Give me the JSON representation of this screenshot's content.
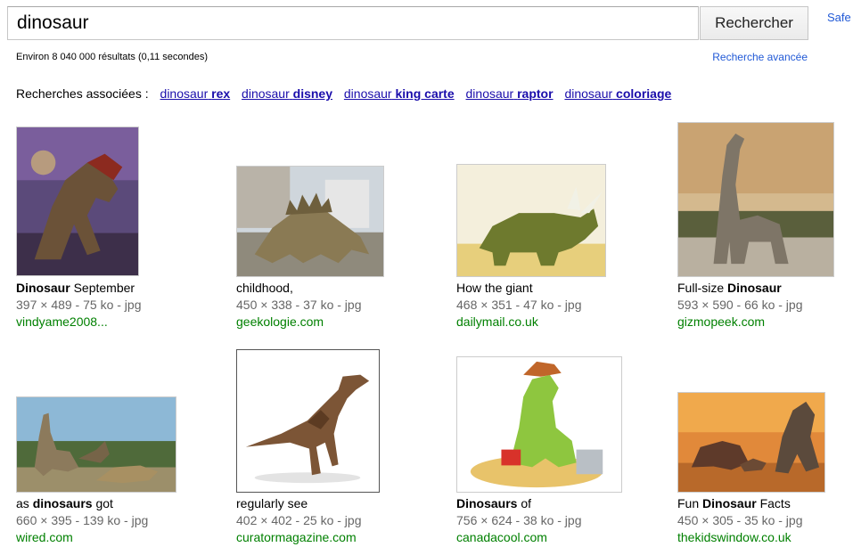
{
  "search": {
    "query": "dinosaur",
    "button_label": "Rechercher",
    "safe_label": "Safe"
  },
  "stats": {
    "text": "Environ 8 040 000 résultats (0,11 secondes)",
    "advanced_label": "Recherche avancée"
  },
  "related": {
    "label": "Recherches associées :",
    "items": [
      {
        "prefix": "dinosaur",
        "bold": "rex"
      },
      {
        "prefix": "dinosaur",
        "bold": "disney"
      },
      {
        "prefix": "dinosaur",
        "bold": "king carte"
      },
      {
        "prefix": "dinosaur",
        "bold": "raptor"
      },
      {
        "prefix": "dinosaur",
        "bold": "coloriage"
      }
    ]
  },
  "results": [
    {
      "title_bold": "Dinosaur",
      "title_rest": " September",
      "meta": "397 × 489 - 75 ko - jpg",
      "site": "vindyame2008..."
    },
    {
      "title_bold": "",
      "title_rest": "childhood,",
      "meta": "450 × 338 - 37 ko - jpg",
      "site": "geekologie.com"
    },
    {
      "title_bold": "",
      "title_rest": "How the giant",
      "meta": "468 × 351 - 47 ko - jpg",
      "site": "dailymail.co.uk"
    },
    {
      "title_bold": "Dinosaur",
      "title_rest": "Full-size ",
      "meta": "593 × 590 - 66 ko - jpg",
      "site": "gizmopeek.com"
    },
    {
      "title_bold": "dinosaurs",
      "title_rest": "as ",
      "title_after": " got",
      "meta": "660 × 395 - 139 ko - jpg",
      "site": "wired.com"
    },
    {
      "title_bold": "",
      "title_rest": "regularly see",
      "meta": "402 × 402 - 25 ko - jpg",
      "site": "curatormagazine.com"
    },
    {
      "title_bold": "Dinosaurs",
      "title_rest": " of",
      "meta": "756 × 624 - 38 ko - jpg",
      "site": "canadacool.com"
    },
    {
      "title_bold": "Dinosaur",
      "title_rest": "Fun ",
      "title_after": " Facts",
      "meta": "450 × 305 - 35 ko - jpg",
      "site": "thekidswindow.co.uk"
    }
  ],
  "colors": {
    "link_blue": "#1a0dab",
    "site_green": "#008000",
    "meta_gray": "#666666"
  }
}
